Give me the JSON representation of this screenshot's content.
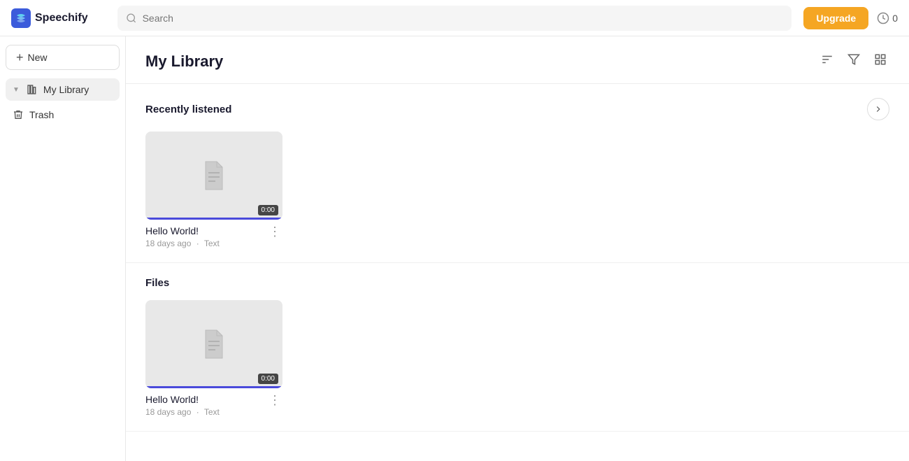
{
  "app": {
    "name": "Speechify",
    "logo_alt": "Speechify logo"
  },
  "topnav": {
    "search_placeholder": "Search",
    "upgrade_label": "Upgrade",
    "credits_count": "0"
  },
  "sidebar": {
    "new_button_label": "New",
    "items": [
      {
        "id": "my-library",
        "label": "My Library",
        "icon": "bar-chart",
        "active": true
      },
      {
        "id": "trash",
        "label": "Trash",
        "icon": "trash",
        "active": false
      }
    ]
  },
  "main": {
    "page_title": "My Library",
    "sort_icon": "sort",
    "filter_icon": "filter",
    "grid_icon": "grid",
    "sections": [
      {
        "id": "recently-listened",
        "title": "Recently listened",
        "items": [
          {
            "id": "item-1",
            "name": "Hello World!",
            "meta_time": "18 days ago",
            "meta_type": "Text",
            "duration": "0:00"
          }
        ]
      },
      {
        "id": "files",
        "title": "Files",
        "items": [
          {
            "id": "item-2",
            "name": "Hello World!",
            "meta_time": "18 days ago",
            "meta_type": "Text",
            "duration": "0:00"
          }
        ]
      }
    ]
  }
}
